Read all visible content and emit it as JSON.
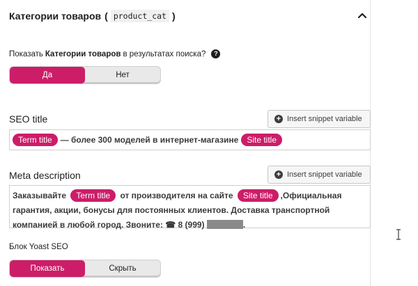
{
  "header": {
    "title": "Категории товаров",
    "code": "product_cat",
    "open_paren": "(",
    "close_paren": ")"
  },
  "search_visibility": {
    "prefix": "Показать",
    "bold": "Категории товаров",
    "suffix": "в результатах поиска?",
    "help_glyph": "?",
    "options": [
      "Да",
      "Нет"
    ],
    "selected": "Да"
  },
  "seo_title": {
    "label": "SEO title",
    "insert_button": "Insert snippet variable",
    "pill_1": "Term title",
    "text": "— более 300 моделей в интернет-магазине",
    "pill_2": "Site title"
  },
  "meta_description": {
    "label": "Meta description",
    "insert_button": "Insert snippet variable",
    "text_1": "Заказывайте",
    "pill_1": "Term title",
    "text_2": "от производителя на сайте",
    "pill_2": "Site title",
    "text_3": ",Официальная гарантия, акции, бонусы для постоянных клиентов. Доставка транспортной компанией в любой город. Звоните: ☎ 8 (999)",
    "text_end": "."
  },
  "yoast_block": {
    "label": "Блок Yoast SEO",
    "options": [
      "Показать",
      "Скрыть"
    ],
    "selected": "Показать"
  },
  "icons": {
    "collapse": "chevron-up-icon",
    "help": "help-icon",
    "insert": "plus-circle-icon",
    "cursor": "text-cursor-icon"
  },
  "colors": {
    "accent": "#cc1d68"
  }
}
